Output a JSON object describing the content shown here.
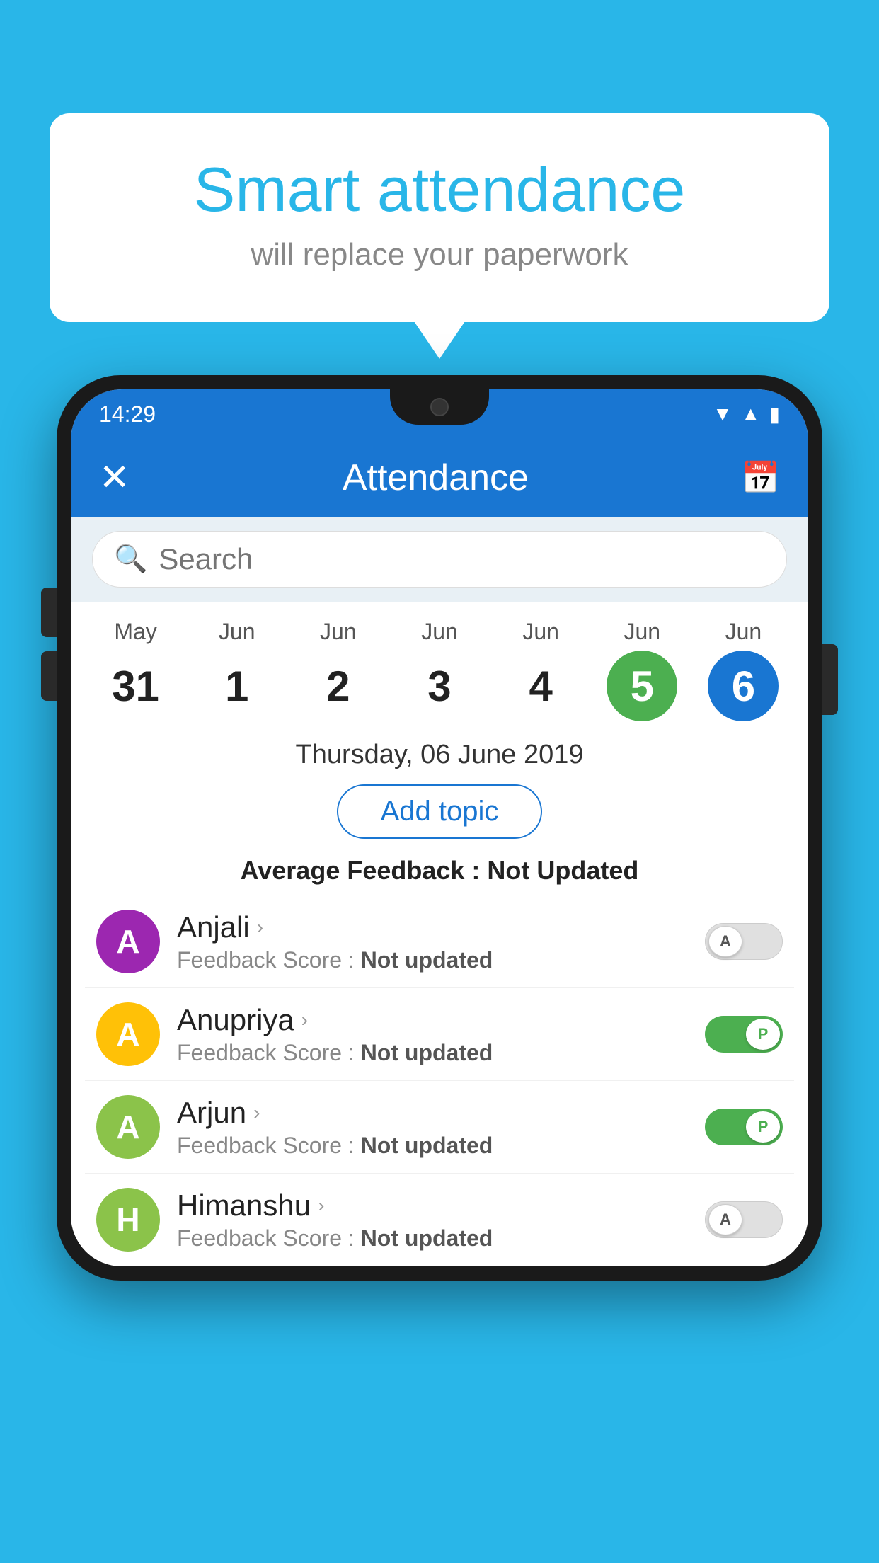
{
  "background_color": "#29b6e8",
  "bubble": {
    "title": "Smart attendance",
    "subtitle": "will replace your paperwork"
  },
  "status_bar": {
    "time": "14:29",
    "icons": [
      "wifi",
      "signal",
      "battery"
    ]
  },
  "app_bar": {
    "close_label": "✕",
    "title": "Attendance",
    "calendar_icon": "🗓"
  },
  "search": {
    "placeholder": "Search"
  },
  "calendar": {
    "days": [
      {
        "month": "May",
        "date": "31",
        "highlight": ""
      },
      {
        "month": "Jun",
        "date": "1",
        "highlight": ""
      },
      {
        "month": "Jun",
        "date": "2",
        "highlight": ""
      },
      {
        "month": "Jun",
        "date": "3",
        "highlight": ""
      },
      {
        "month": "Jun",
        "date": "4",
        "highlight": ""
      },
      {
        "month": "Jun",
        "date": "5",
        "highlight": "green"
      },
      {
        "month": "Jun",
        "date": "6",
        "highlight": "blue"
      }
    ]
  },
  "date_heading": "Thursday, 06 June 2019",
  "add_topic_label": "Add topic",
  "avg_feedback_label": "Average Feedback : ",
  "avg_feedback_value": "Not Updated",
  "students": [
    {
      "name": "Anjali",
      "initial": "A",
      "avatar_color": "#9c27b0",
      "feedback_label": "Feedback Score : ",
      "feedback_value": "Not updated",
      "toggle_state": "off",
      "toggle_letter": "A"
    },
    {
      "name": "Anupriya",
      "initial": "A",
      "avatar_color": "#ffc107",
      "feedback_label": "Feedback Score : ",
      "feedback_value": "Not updated",
      "toggle_state": "on",
      "toggle_letter": "P"
    },
    {
      "name": "Arjun",
      "initial": "A",
      "avatar_color": "#8bc34a",
      "feedback_label": "Feedback Score : ",
      "feedback_value": "Not updated",
      "toggle_state": "on",
      "toggle_letter": "P"
    },
    {
      "name": "Himanshu",
      "initial": "H",
      "avatar_color": "#8bc34a",
      "feedback_label": "Feedback Score : ",
      "feedback_value": "Not updated",
      "toggle_state": "off",
      "toggle_letter": "A"
    }
  ]
}
